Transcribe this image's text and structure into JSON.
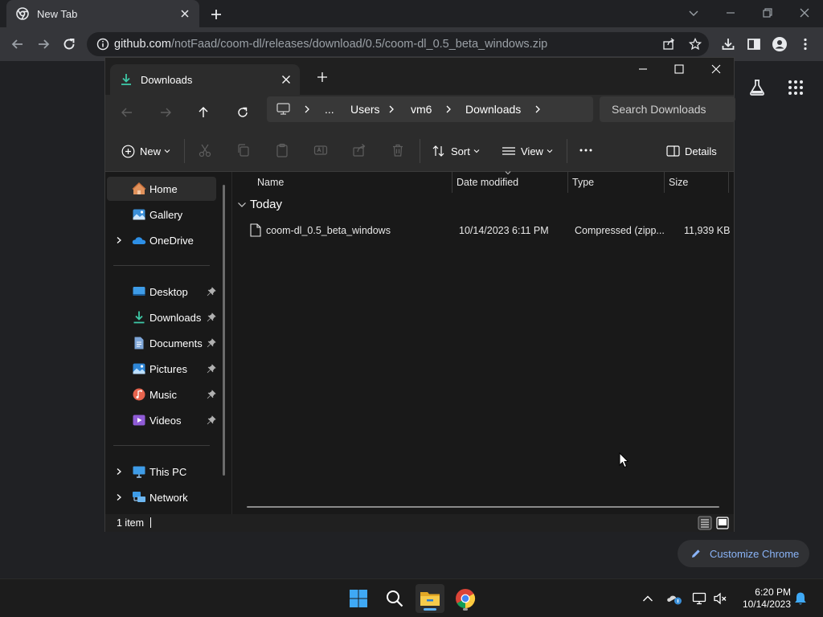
{
  "chrome": {
    "tab_title": "New Tab",
    "url_host": "github.com",
    "url_path": "/notFaad/coom-dl/releases/download/0.5/coom-dl_0.5_beta_windows.zip",
    "customize_label": "Customize Chrome",
    "colors": {
      "frame": "#202124",
      "toolbar": "#35363a",
      "link": "#8ab4f8"
    }
  },
  "explorer": {
    "tab_title": "Downloads",
    "breadcrumb": [
      "...",
      "Users",
      "vm6",
      "Downloads"
    ],
    "search_placeholder": "Search Downloads",
    "toolbar": {
      "new_label": "New",
      "sort_label": "Sort",
      "view_label": "View",
      "details_label": "Details"
    },
    "nav": {
      "top": [
        {
          "label": "Home",
          "icon": "home-icon",
          "selected": true
        },
        {
          "label": "Gallery",
          "icon": "gallery-icon"
        },
        {
          "label": "OneDrive",
          "icon": "onedrive-icon",
          "expandable": true
        }
      ],
      "pinned": [
        {
          "label": "Desktop",
          "icon": "desktop-icon"
        },
        {
          "label": "Downloads",
          "icon": "downloads-icon"
        },
        {
          "label": "Documents",
          "icon": "documents-icon"
        },
        {
          "label": "Pictures",
          "icon": "pictures-icon"
        },
        {
          "label": "Music",
          "icon": "music-icon"
        },
        {
          "label": "Videos",
          "icon": "videos-icon"
        }
      ],
      "bottom": [
        {
          "label": "This PC",
          "icon": "this-pc-icon",
          "expandable": true
        },
        {
          "label": "Network",
          "icon": "network-icon",
          "expandable": true
        }
      ]
    },
    "columns": [
      "Name",
      "Date modified",
      "Type",
      "Size"
    ],
    "group_label": "Today",
    "files": [
      {
        "name": "coom-dl_0.5_beta_windows",
        "date_modified": "10/14/2023 6:11 PM",
        "type": "Compressed (zipp...",
        "size": "11,939 KB"
      }
    ],
    "status": {
      "item_count": "1 item"
    },
    "colors": {
      "background": "#191919",
      "bar": "#2c2c2c",
      "accent": "#5fb2f2"
    }
  },
  "taskbar": {
    "clock_time": "6:20 PM",
    "clock_date": "10/14/2023"
  }
}
